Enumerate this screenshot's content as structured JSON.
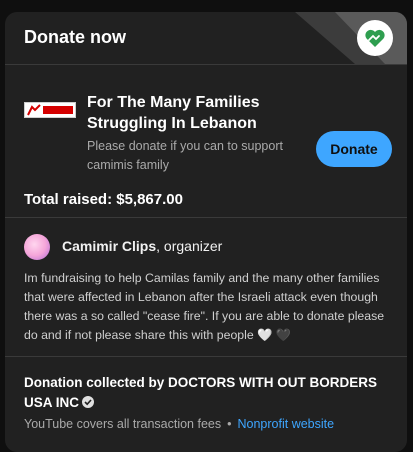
{
  "header": {
    "title": "Donate now",
    "badge_icon": "heart-hand-icon",
    "accent_color": "#2e9e4f"
  },
  "campaign": {
    "logo_icon": "msf-logo",
    "title": "For The Many Families Struggling In Lebanon",
    "description": "Please donate if you can to support camimis family",
    "donate_label": "Donate",
    "total_raised": "Total raised: $5,867.00",
    "button_color": "#3ea6ff"
  },
  "organizer": {
    "name": "Camimir Clips",
    "role": ", organizer",
    "message": "Im fundraising to help Camilas family and the many other families that were affected in Lebanon after the Israeli attack even though there was a so called \"cease fire\". If you are able to donate please do and if not please share this with people 🤍 🖤"
  },
  "collection": {
    "title": "Donation collected by DOCTORS WITH OUT BORDERS USA INC",
    "fees_text": "YouTube covers all transaction fees",
    "separator": "•",
    "nonprofit_link": "Nonprofit website"
  }
}
